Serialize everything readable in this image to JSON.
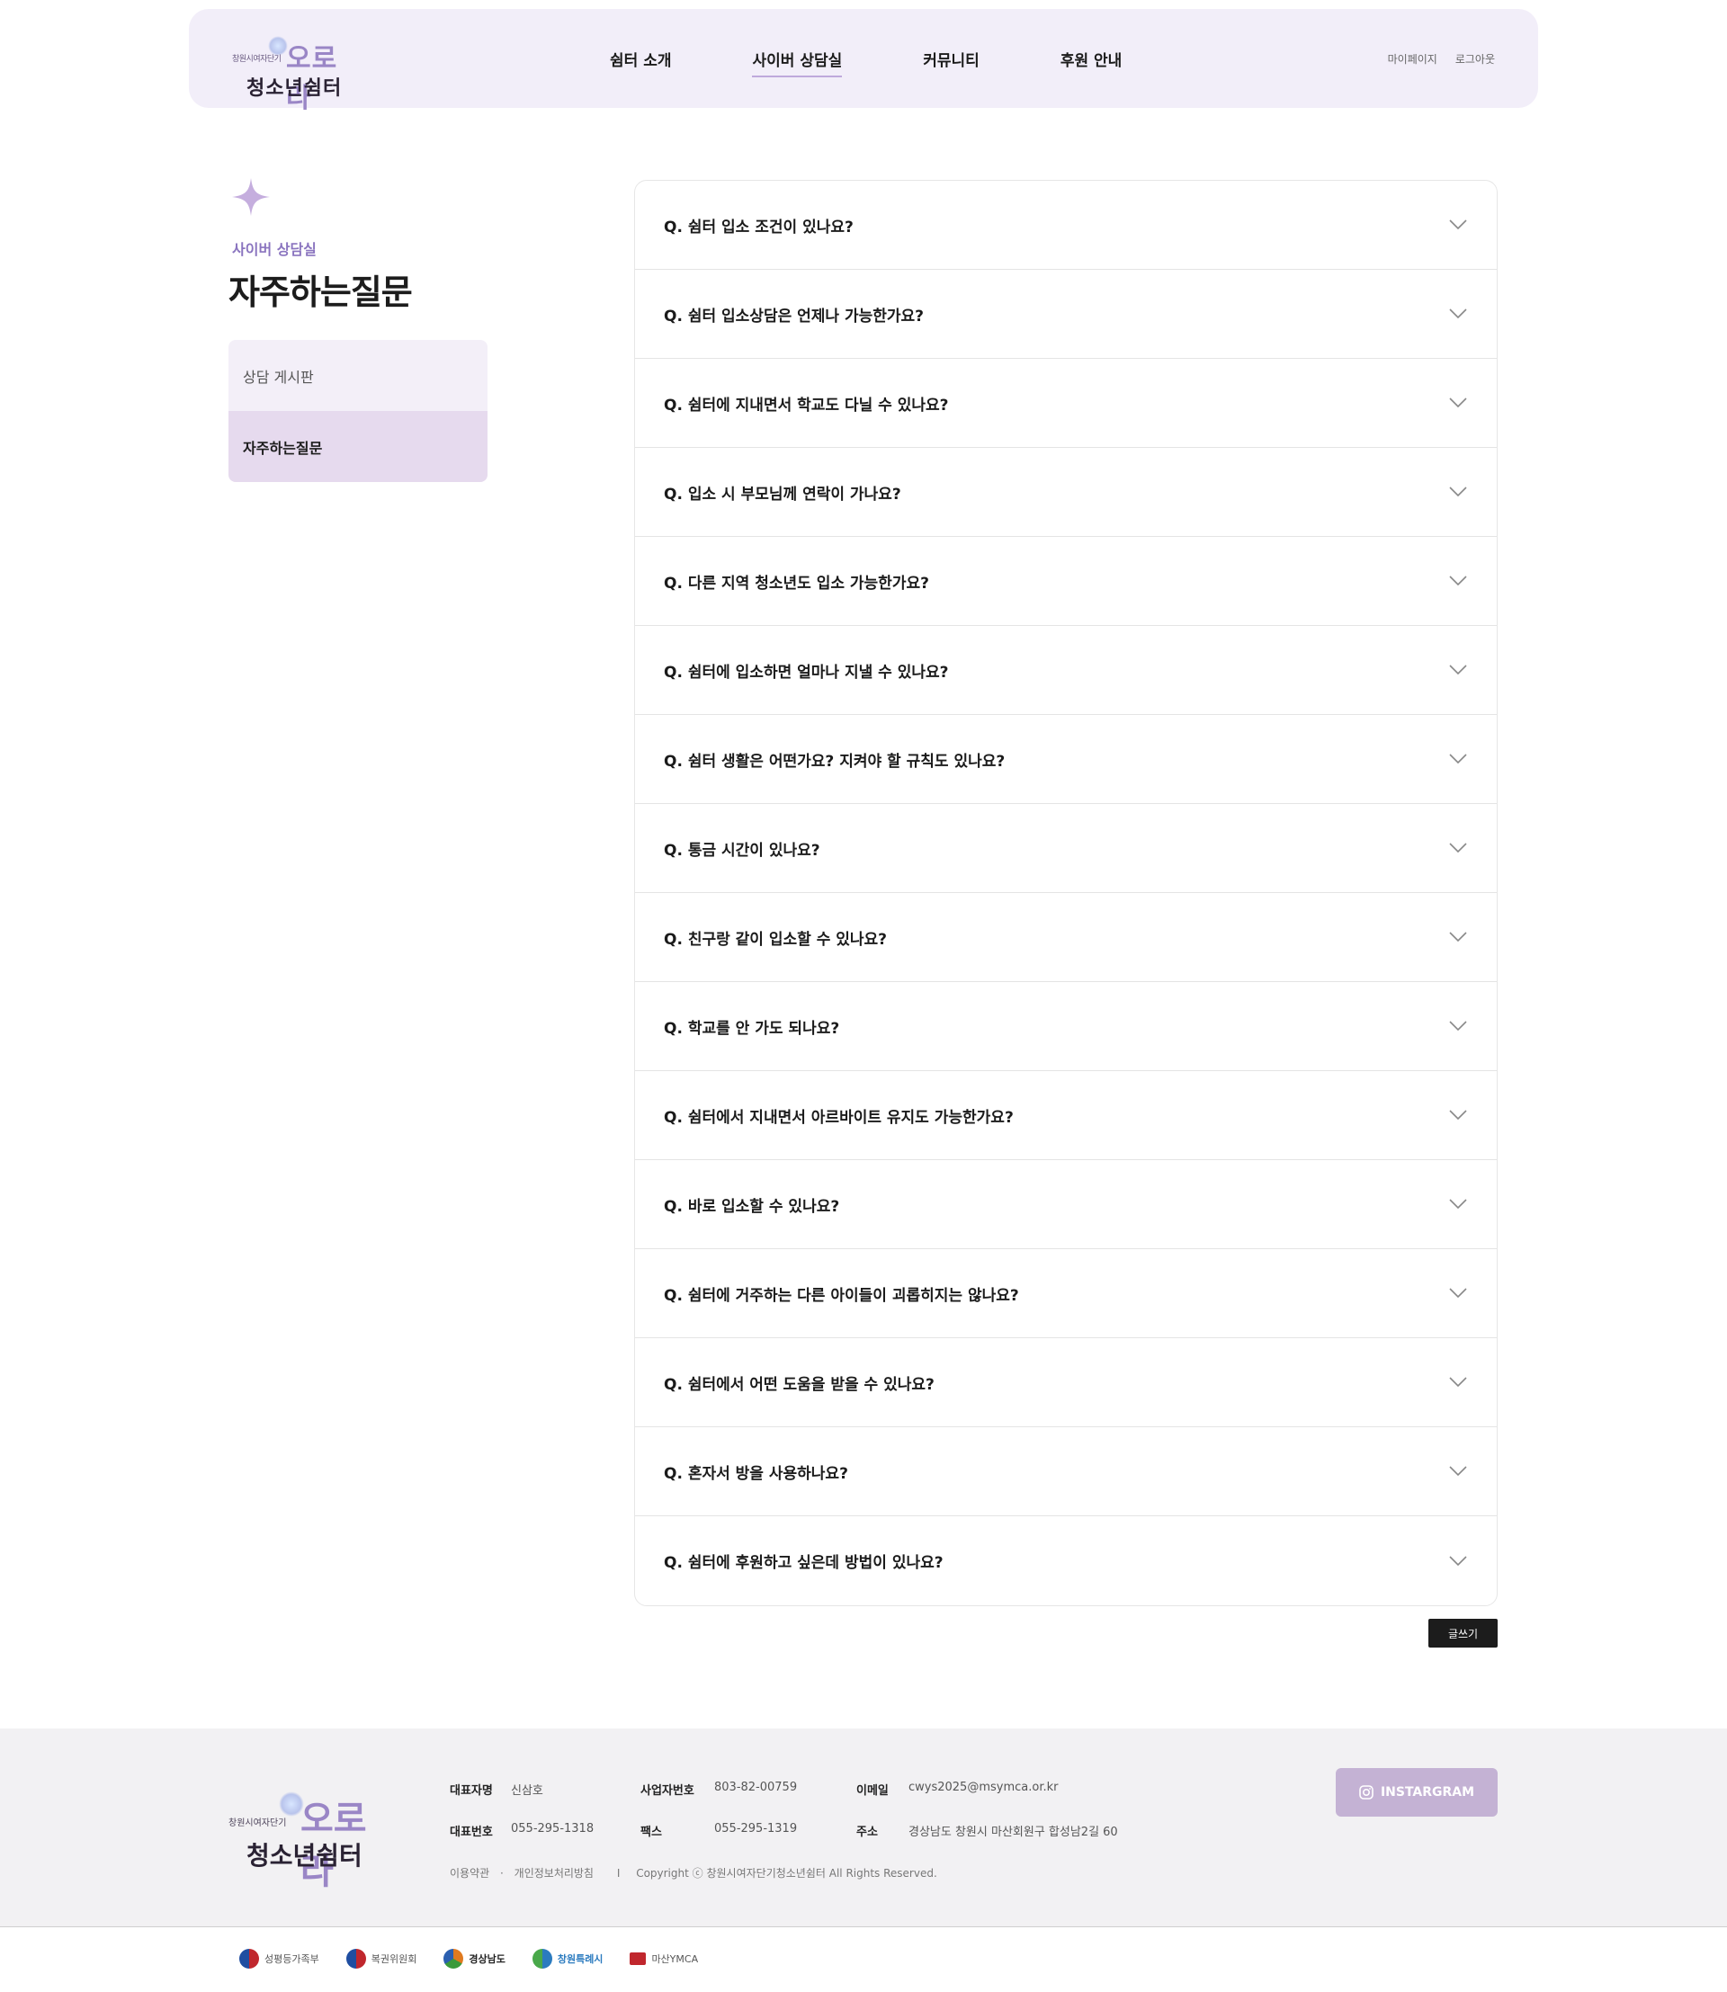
{
  "header": {
    "logo_small": "창원시여자단기",
    "logo_big": "오로라",
    "logo_sub": "청소년쉼터",
    "nav": [
      "쉼터 소개",
      "사이버 상담실",
      "커뮤니티",
      "후원 안내"
    ],
    "util": [
      "마이페이지",
      "로그아웃"
    ]
  },
  "sidebar": {
    "crumb": "사이버 상담실",
    "title": "자주하는질문",
    "items": [
      {
        "label": "상담 게시판"
      },
      {
        "label": "자주하는질문"
      }
    ]
  },
  "faq": [
    "Q. 쉼터 입소 조건이 있나요?",
    "Q. 쉼터 입소상담은 언제나 가능한가요?",
    "Q. 쉼터에 지내면서 학교도 다닐 수 있나요?",
    "Q. 입소 시 부모님께 연락이 가나요?",
    "Q. 다른 지역 청소년도 입소 가능한가요?",
    "Q. 쉼터에 입소하면 얼마나 지낼 수 있나요?",
    "Q. 쉼터 생활은 어떤가요? 지켜야 할 규칙도 있나요?",
    "Q. 통금 시간이 있나요?",
    "Q. 친구랑 같이 입소할 수 있나요?",
    "Q. 학교를 안 가도 되나요?",
    "Q. 쉼터에서 지내면서 아르바이트 유지도 가능한가요?",
    "Q. 바로 입소할 수 있나요?",
    "Q. 쉼터에 거주하는 다른 아이들이 괴롭히지는 않나요?",
    "Q. 쉼터에서 어떤 도움을 받을 수 있나요?",
    "Q. 혼자서 방을 사용하나요?",
    "Q. 쉼터에 후원하고 싶은데 방법이 있나요?"
  ],
  "write_button": "글쓰기",
  "footer": {
    "logo_small": "창원시여자단기",
    "logo_big": "오로라",
    "logo_sub": "청소년쉼터",
    "rep_label": "대표자명",
    "rep_value": "신삼호",
    "biz_label": "사업자번호",
    "biz_value": "803-82-00759",
    "email_label": "이메일",
    "email_value": "cwys2025@msymca.or.kr",
    "tel_label": "대표번호",
    "tel_value": "055-295-1318",
    "fax_label": "팩스",
    "fax_value": "055-295-1319",
    "addr_label": "주소",
    "addr_value": "경상남도 창원시 마산회원구 합성남2길 60",
    "terms": "이용약관",
    "sep": "·",
    "privacy": "개인정보처리방침",
    "bar": "I",
    "copyright": "Copyright ⓒ 창원시여자단기청소년쉼터 All Rights Reserved.",
    "instagram": "INSTARGRAM"
  },
  "partners": [
    {
      "label": "성평등가족부",
      "color": "#1f4ea1"
    },
    {
      "label": "복권위원회",
      "color": "#1f4ea1"
    },
    {
      "label": "경상남도",
      "color": "#e07a1f"
    },
    {
      "label": "창원특례시",
      "color": "#2b7bbf"
    },
    {
      "label": "마산YMCA",
      "color": "#c0272d"
    }
  ],
  "colors": {
    "accent": "#8a74bf",
    "header_bg": "#f2eef9",
    "instagram_bg": "#c4b2d4"
  }
}
